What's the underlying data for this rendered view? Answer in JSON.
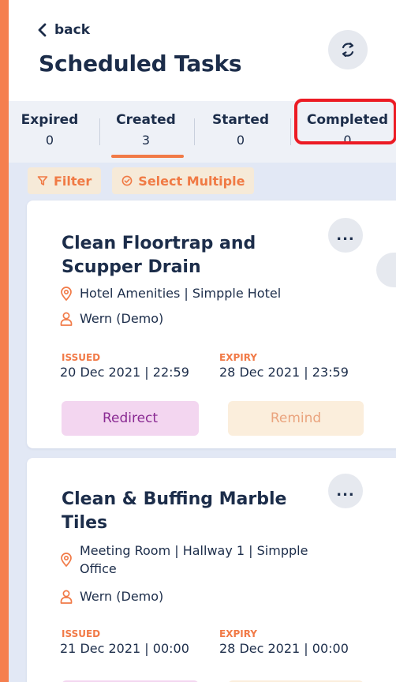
{
  "header": {
    "back_label": "back",
    "title": "Scheduled Tasks"
  },
  "tabs": [
    {
      "label": "Expired",
      "count": "0"
    },
    {
      "label": "Created",
      "count": "3"
    },
    {
      "label": "Started",
      "count": "0"
    },
    {
      "label": "Completed",
      "count": "0"
    }
  ],
  "active_tab": "Created",
  "highlighted_tab": "Completed",
  "toolbar": {
    "filter_label": "Filter",
    "select_multiple_label": "Select Multiple"
  },
  "tasks": [
    {
      "title": "Clean Floortrap and Scupper Drain",
      "location": "Hotel Amenities  |  Simpple Hotel",
      "assignee": "Wern (Demo)",
      "issued_label": "ISSUED",
      "issued": "20 Dec 2021 | 22:59",
      "expiry_label": "EXPIRY",
      "expiry": "28 Dec 2021 | 23:59",
      "redirect_label": "Redirect",
      "remind_label": "Remind",
      "more_label": "..."
    },
    {
      "title": "Clean & Buffing Marble Tiles",
      "location": "Meeting Room  |  Hallway 1  |  Simpple Office",
      "assignee": "Wern (Demo)",
      "issued_label": "ISSUED",
      "issued": "21 Dec 2021 | 00:00",
      "expiry_label": "EXPIRY",
      "expiry": "28 Dec 2021 | 00:00",
      "more_label": "..."
    }
  ],
  "icons": {
    "back": "chevron-left-icon",
    "refresh": "refresh-icon",
    "filter": "funnel-icon",
    "select": "check-circle-icon",
    "location": "map-pin-icon",
    "assignee": "user-icon"
  },
  "colors": {
    "accent": "#f17a47",
    "highlight": "#ec1b24",
    "text": "#1c2d4a",
    "redirect_bg": "#f3d6f0",
    "remind_bg": "#fbeedc"
  }
}
